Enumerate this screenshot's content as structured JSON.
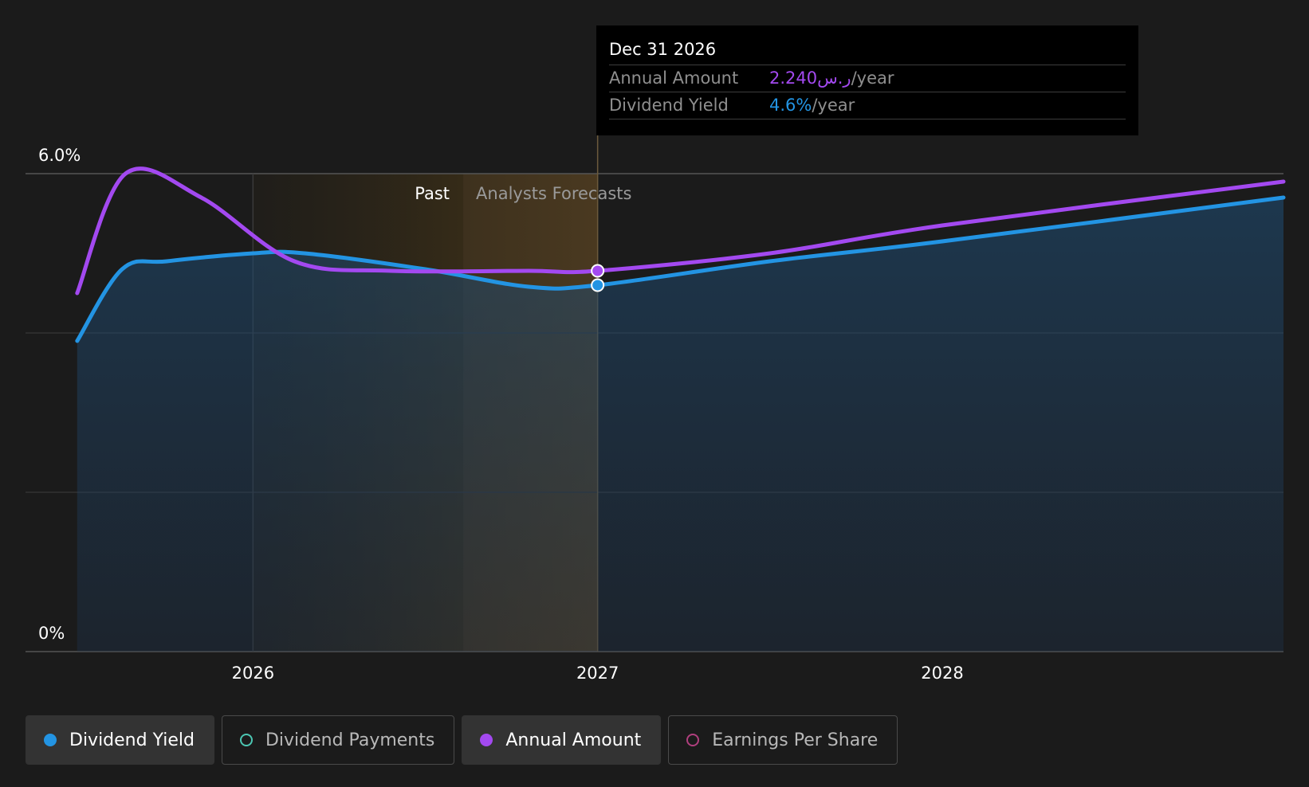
{
  "chart_data": {
    "type": "area",
    "y_axis": {
      "top_label": "6.0%",
      "bottom_label": "0%",
      "ylim": [
        0,
        6.0
      ]
    },
    "x_axis": {
      "ticks": [
        {
          "label": "2026",
          "x": 2026.0
        },
        {
          "label": "2027",
          "x": 2027.0
        },
        {
          "label": "2028",
          "x": 2028.0
        }
      ],
      "xlim": [
        2025.34,
        2028.99
      ]
    },
    "regions": {
      "past_label": "Past",
      "forecast_label": "Analysts Forecasts",
      "past_start": 2026.0,
      "highlight_start": 2026.61,
      "past_end": 2027.0
    },
    "series": [
      {
        "name": "Dividend Yield",
        "color": "#2394e3",
        "filled": true,
        "points": [
          [
            2025.49,
            3.9
          ],
          [
            2025.62,
            4.8
          ],
          [
            2025.75,
            4.9
          ],
          [
            2026.0,
            5.0
          ],
          [
            2026.15,
            5.0
          ],
          [
            2026.5,
            4.8
          ],
          [
            2026.8,
            4.58
          ],
          [
            2027.0,
            4.6
          ],
          [
            2027.5,
            4.9
          ],
          [
            2028.0,
            5.15
          ],
          [
            2028.99,
            5.7
          ]
        ]
      },
      {
        "name": "Annual Amount",
        "color": "#a349f0",
        "filled": false,
        "points": [
          [
            2025.49,
            4.5
          ],
          [
            2025.63,
            6.0
          ],
          [
            2025.85,
            5.7
          ],
          [
            2026.12,
            4.9
          ],
          [
            2026.4,
            4.78
          ],
          [
            2026.8,
            4.78
          ],
          [
            2027.0,
            4.78
          ],
          [
            2027.5,
            5.0
          ],
          [
            2028.0,
            5.35
          ],
          [
            2028.99,
            5.9
          ]
        ]
      }
    ],
    "highlight": {
      "x": 2027.0,
      "values": [
        4.6,
        4.78
      ]
    },
    "tooltip": {
      "date": "Dec 31 2026",
      "rows": [
        {
          "label": "Annual Amount",
          "value": "2.240ر.س",
          "unit": "/year",
          "color": "#a349f0"
        },
        {
          "label": "Dividend Yield",
          "value": "4.6%",
          "unit": "/year",
          "color": "#2394e3"
        }
      ]
    }
  },
  "legend": [
    {
      "label": "Dividend Yield",
      "color": "#2394e3",
      "active": true
    },
    {
      "label": "Dividend Payments",
      "color": "#4cc7b3",
      "active": false
    },
    {
      "label": "Annual Amount",
      "color": "#a349f0",
      "active": true
    },
    {
      "label": "Earnings Per Share",
      "color": "#b03f7e",
      "active": false
    }
  ]
}
